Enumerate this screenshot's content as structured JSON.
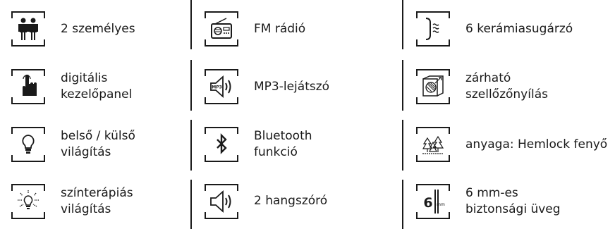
{
  "features": [
    {
      "label": "2 személyes",
      "icon": "two-persons-icon"
    },
    {
      "label": "FM rádió",
      "icon": "radio-icon"
    },
    {
      "label": "6 kerámiasugárzó",
      "icon": "ceramic-heater-icon"
    },
    {
      "label": "digitális\nkezelőpanel",
      "icon": "touch-panel-icon"
    },
    {
      "label": "MP3-lejátszó",
      "icon": "mp3-speaker-icon"
    },
    {
      "label": "zárható\nszellőzőnyílás",
      "icon": "ventilation-icon"
    },
    {
      "label": "belső / külső\nvilágítás",
      "icon": "lightbulb-icon"
    },
    {
      "label": "Bluetooth\nfunkció",
      "icon": "bluetooth-icon"
    },
    {
      "label": "anyaga: Hemlock fenyő",
      "icon": "trees-icon"
    },
    {
      "label": "színterápiás\nvilágítás",
      "icon": "color-light-icon"
    },
    {
      "label": "2 hangszóró",
      "icon": "speaker-icon"
    },
    {
      "label": "6 mm-es\nbiztonsági üveg",
      "icon": "glass-thickness-icon"
    }
  ],
  "glass_badge": {
    "number": "6",
    "unit": "mm"
  },
  "mp3_badge": "MP3"
}
